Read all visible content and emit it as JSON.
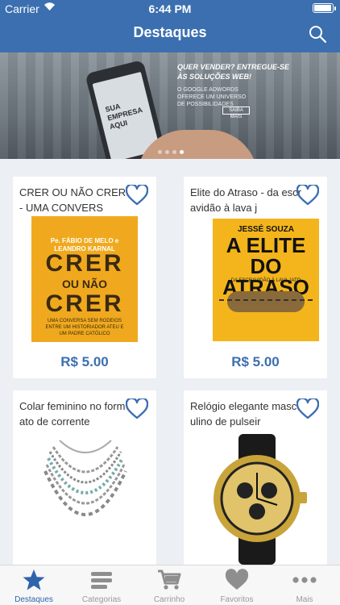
{
  "status": {
    "carrier": "Carrier",
    "time": "6:44 PM"
  },
  "nav": {
    "title": "Destaques"
  },
  "banner": {
    "screen_text": "SUA EMPRESA AQUI",
    "promo_line1": "QUER VENDER? ENTREGUE-SE",
    "promo_line2": "ÀS SOLUÇÕES WEB!",
    "promo_sub": "O GOOGLE ADWORDS OFERECE UM UNIVERSO DE POSSIBILIDADES",
    "promo_button": "SAIBA MAIS",
    "slides": 4,
    "active_slide": 3
  },
  "products": [
    {
      "title": "CRER OU NÃO CRER - UMA CONVERS",
      "price": "R$ 5.00",
      "cover": {
        "author": "Pe. FÁBIO DE MELO e LEANDRO KARNAL",
        "word1": "CRER",
        "word2": "OU NÃO",
        "word3": "CRER",
        "blurb": "UMA CONVERSA SEM RODEIOS ENTRE UM HISTORIADOR ATEU E UM PADRE CATÓLICO"
      }
    },
    {
      "title": "Elite do Atraso - da escravidão à lava j",
      "price": "R$ 5.00",
      "cover": {
        "author": "JESSÉ SOUZA",
        "line1": "A ELITE",
        "line2": "DO ATRASO",
        "sub": "DA ESCRAVIDÃO À LAVA JATO"
      }
    },
    {
      "title": "Colar feminino no formato de corrente"
    },
    {
      "title": "Relógio elegante masculino de pulseir"
    }
  ],
  "tabs": [
    {
      "label": "Destaques",
      "icon": "star-icon"
    },
    {
      "label": "Categorias",
      "icon": "list-icon"
    },
    {
      "label": "Carrinho",
      "icon": "cart-icon"
    },
    {
      "label": "Favoritos",
      "icon": "heart-icon"
    },
    {
      "label": "Mais",
      "icon": "more-icon"
    }
  ],
  "colors": {
    "brand": "#3b6fb0",
    "price": "#3b6fb0",
    "tab_active": "#2f64ad",
    "tab_inactive": "#999999"
  }
}
